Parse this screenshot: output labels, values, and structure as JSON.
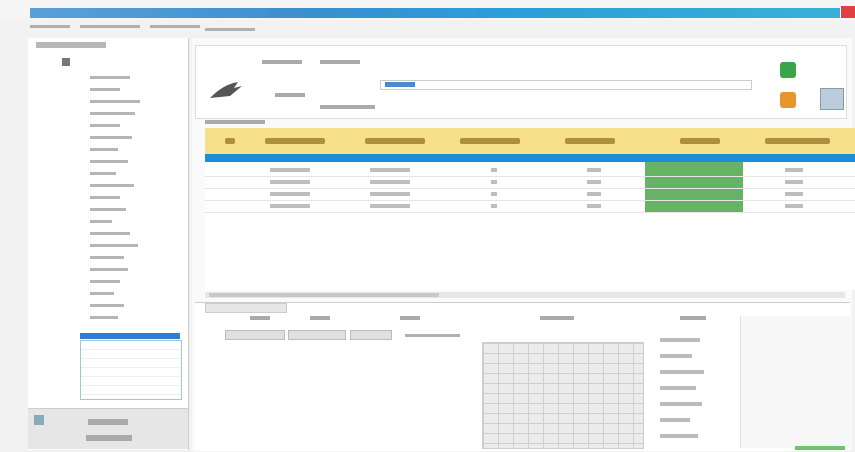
{
  "window": {
    "title": "",
    "accent": "#2a9fd8",
    "close_color": "#e04040"
  },
  "menu": {
    "items": [
      "",
      "",
      "",
      "",
      ""
    ]
  },
  "toolbar": {
    "zoom_hint": ""
  },
  "left_panel": {
    "header": "",
    "items": [
      "",
      "",
      "",
      "",
      "",
      "",
      "",
      "",
      "",
      "",
      "",
      "",
      "",
      "",
      "",
      "",
      "",
      "",
      "",
      "",
      ""
    ],
    "selected_index": 20,
    "footer_buttons": [
      "",
      ""
    ]
  },
  "header_form": {
    "labels": [
      "",
      "",
      "",
      ""
    ],
    "input_value": ""
  },
  "grid": {
    "title": "",
    "header_color": "#f7e08a",
    "selection_color": "#1b8ed8",
    "highlight_color": "#66b366",
    "columns": [
      "",
      "",
      "",
      "",
      "",
      "",
      ""
    ],
    "rows": [
      [
        "",
        "",
        "",
        "",
        "",
        "",
        ""
      ],
      [
        "",
        "",
        "",
        "",
        "",
        "",
        ""
      ],
      [
        "",
        "",
        "",
        "",
        "",
        "",
        ""
      ],
      [
        "",
        "",
        "",
        "",
        "",
        "",
        ""
      ]
    ]
  },
  "detail": {
    "tabs": [
      "",
      ""
    ],
    "headers": [
      "",
      "",
      "",
      "",
      "",
      ""
    ],
    "buttons": [
      "",
      "",
      ""
    ]
  },
  "icons": [
    "logo-icon",
    "status-green-icon",
    "status-orange-icon",
    "panel-icon"
  ]
}
